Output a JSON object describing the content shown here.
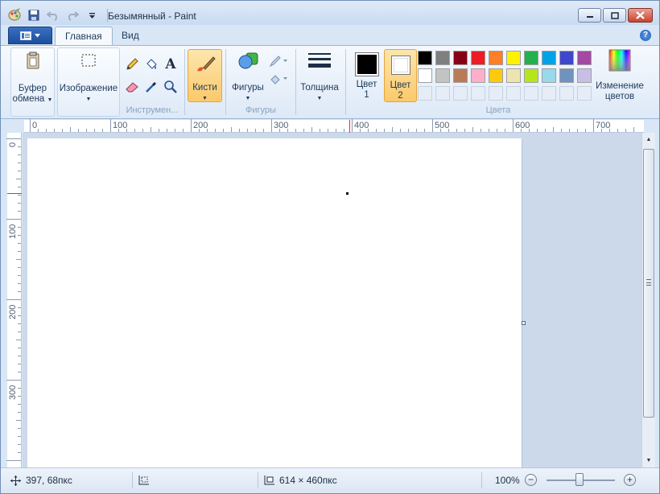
{
  "window": {
    "title": "Безымянный - Paint"
  },
  "ribbon": {
    "tabs": [
      {
        "label": "Главная",
        "active": true
      },
      {
        "label": "Вид",
        "active": false
      }
    ],
    "help_glyph": "?",
    "groups": {
      "clipboard": {
        "button_line1": "Буфер",
        "button_line2": "обмена"
      },
      "image": {
        "button_label": "Изображение"
      },
      "tools": {
        "label": "Инструмен...",
        "icons": [
          "pencil-icon",
          "fill-bucket-icon",
          "text-icon",
          "eraser-icon",
          "color-picker-icon",
          "magnifier-icon"
        ],
        "text_glyph": "A"
      },
      "brushes": {
        "button_label": "Кисти"
      },
      "shapes": {
        "button_label": "Фигуры",
        "label": "Фигуры"
      },
      "size": {
        "button_label": "Толщина"
      },
      "colors": {
        "color1_line1": "Цвет",
        "color1_line2": "1",
        "color1_value": "#000000",
        "color2_line1": "Цвет",
        "color2_line2": "2",
        "color2_value": "#ffffff",
        "label": "Цвета",
        "edit_line1": "Изменение",
        "edit_line2": "цветов",
        "palette_row1": [
          "#000000",
          "#7f7f7f",
          "#880015",
          "#ed1c24",
          "#ff7f27",
          "#fff200",
          "#22b14c",
          "#00a2e8",
          "#3f48cc",
          "#a349a4"
        ],
        "palette_row2": [
          "#ffffff",
          "#c3c3c3",
          "#b97a57",
          "#ffaec9",
          "#ffc90e",
          "#efe4b0",
          "#b5e61d",
          "#99d9ea",
          "#7092be",
          "#c8bfe7"
        ],
        "palette_row3_empty": 10
      }
    }
  },
  "rulers": {
    "horizontal_labels": [
      "0",
      "100",
      "200",
      "300",
      "400",
      "500",
      "600",
      "700"
    ],
    "vertical_labels": [
      "0",
      "100",
      "200",
      "300"
    ]
  },
  "status": {
    "cursor_position": "397, 68пкс",
    "selection_size": "",
    "canvas_size": "614 × 460пкс",
    "zoom": "100%"
  }
}
